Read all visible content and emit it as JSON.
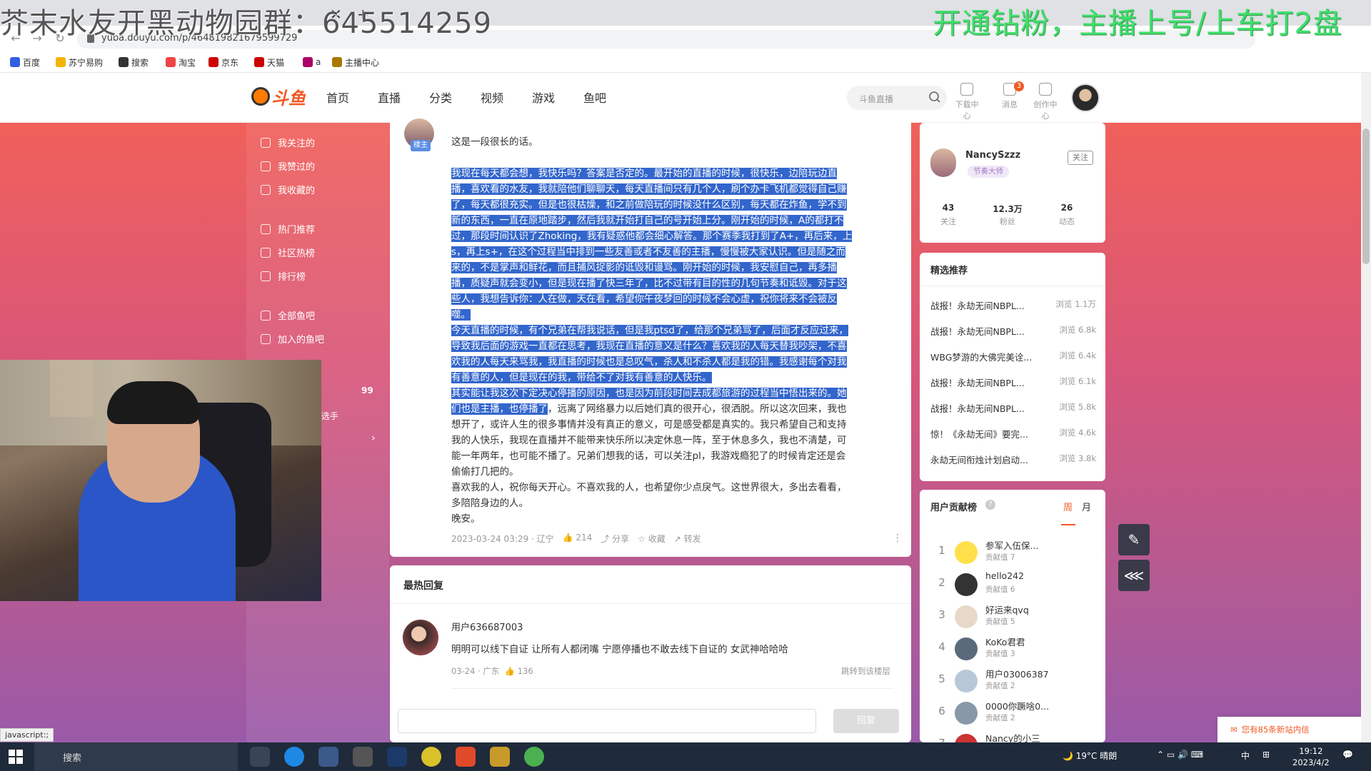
{
  "overlay": {
    "left_text": "芥末水友开黑动物园群：645514259",
    "right_text": "开通钻粉，主播上号/上车打2盘"
  },
  "browser": {
    "url": "yuba.douyu.com/p/464819821679599729",
    "bookmarks": [
      "百度",
      "苏宁易购",
      "搜索",
      "淘宝",
      "京东",
      "天猫",
      "a",
      "主播中心"
    ]
  },
  "header": {
    "logo_text": "斗鱼",
    "nav": [
      "首页",
      "直播",
      "分类",
      "视频",
      "游戏",
      "鱼吧"
    ],
    "search_placeholder": "斗鱼直播",
    "tools": [
      "下载中心",
      "消息",
      "创作中心"
    ],
    "message_badge": "3"
  },
  "left_menu": [
    "我关注的",
    "我赞过的",
    "我收藏的",
    "热门推荐",
    "社区热榜",
    "排行榜",
    "全部鱼吧",
    "加入的鱼吧"
  ],
  "left_dim": {
    "count": "99",
    "text": "选手"
  },
  "post": {
    "author_tag": "楼主",
    "intro": "这是一段很长的话。",
    "lines": [
      {
        "t": "我现在每天都会想，我快乐吗？答案是否定的。最开始的直播的时候，很快乐，边陪玩边直",
        "h": true
      },
      {
        "t": "播，喜欢看的水友，我就陪他们聊聊天，每天直播间只有几个人，刷个办卡飞机都觉得自己赚",
        "h": true
      },
      {
        "t": "了，每天都很充实。但是也很枯燥，和之前做陪玩的时候没什么区别，每天都在炸鱼，学不到",
        "h": true
      },
      {
        "t": "新的东西，一直在原地踏步，然后我就开始打自己的号开始上分。刚开始的时候，A的都打不",
        "h": true
      },
      {
        "t": "过，那段时间认识了Zhoking，我有疑惑他都会细心解答。那个赛季我打到了A+，再后来，上",
        "h": true
      },
      {
        "t": "s，再上s+，在这个过程当中排到一些友善或者不友善的主播，慢慢被大家认识。但是随之而",
        "h": true
      },
      {
        "t": "来的，不是掌声和鲜花，而且捕风捉影的诋毁和谩骂。刚开始的时候，我安慰自己，再多播",
        "h": true
      },
      {
        "t": "播，质疑声就会变小，但是现在播了快三年了，比不过带有目的性的几句节奏和诋毁。对于这",
        "h": true
      },
      {
        "t": "些人，我想告诉你：人在做，天在看，希望你午夜梦回的时候不会心虚，祝你将来不会被反",
        "h": true
      },
      {
        "t": "噬。",
        "h": true
      },
      {
        "t": "今天直播的时候，有个兄弟在帮我说话，但是我ptsd了，给那个兄弟骂了，后面才反应过来，",
        "h": true
      },
      {
        "t": "导致我后面的游戏一直都在思考，我现在直播的意义是什么？喜欢我的人每天替我吵架，不喜",
        "h": true
      },
      {
        "t": "欢我的人每天来骂我，我直播的时候也是总叹气，杀人和不杀人都是我的错。我感谢每个对我",
        "h": true
      },
      {
        "t": "有善意的人，但是现在的我，带给不了对我有善意的人快乐。",
        "h": true
      },
      {
        "t": "其实能让我这次下定决心停播的原因，也是因为前段时间去成都旅游的过程当中悟出来的。她",
        "h": true
      },
      {
        "t": "们也是主播，也停播了，远离了网络暴力以后她们真的很开心，很洒脱。所以这次回来，我也",
        "h": "partial",
        "split": "们也是主播，也停播了"
      },
      {
        "t": "想开了，或许人生的很多事情并没有真正的意义，可是感受都是真实的。我只希望自己和支持",
        "h": false
      },
      {
        "t": "我的人快乐，我现在直播并不能带来快乐所以决定休息一阵，至于休息多久，我也不清楚，可",
        "h": false
      },
      {
        "t": "能一年两年，也可能不播了。兄弟们想我的话，可以关注pl，我游戏瘾犯了的时候肯定还是会",
        "h": false
      },
      {
        "t": "偷偷打几把的。",
        "h": false
      },
      {
        "t": "喜欢我的人，祝你每天开心。不喜欢我的人，也希望你少点戾气。这世界很大，多出去看看，",
        "h": false
      },
      {
        "t": "多陪陪身边的人。",
        "h": false
      },
      {
        "t": "晚安。",
        "h": false
      }
    ],
    "meta": {
      "time": "2023-03-24 03:29 · 辽宁",
      "likes": "214",
      "share": "分享",
      "collect": "收藏",
      "forward": "转发"
    }
  },
  "hot_reply": {
    "title": "最热回复",
    "name": "用户636687003",
    "text": "明明可以线下自证 让所有人都闭嘴 宁愿停播也不敢去线下自证的 女武神哈哈哈",
    "meta": "03-24 · 广东",
    "likes": "136",
    "jump": "跳转到该楼层",
    "reply_btn": "回复"
  },
  "anchor": {
    "name": "NancySzzz",
    "badge": "节奏大师",
    "follow": "关注",
    "stats": [
      {
        "num": "43",
        "label": "关注"
      },
      {
        "num": "12.3万",
        "label": "粉丝"
      },
      {
        "num": "26",
        "label": "动态"
      }
    ]
  },
  "recommend": {
    "title": "精选推荐",
    "items": [
      {
        "t": "战报！永劫无间NBPL...",
        "v": "浏览 1.1万"
      },
      {
        "t": "战报！永劫无间NBPL...",
        "v": "浏览 6.8k"
      },
      {
        "t": "WBG梦游的大佛完美诠...",
        "v": "浏览 6.4k"
      },
      {
        "t": "战报！永劫无间NBPL...",
        "v": "浏览 6.1k"
      },
      {
        "t": "战报！永劫无间NBPL...",
        "v": "浏览 5.8k"
      },
      {
        "t": "惊！《永劫无间》要完...",
        "v": "浏览 4.6k"
      },
      {
        "t": "永劫无间衔烛计划启动...",
        "v": "浏览 3.8k"
      }
    ]
  },
  "ranking": {
    "title": "用户贡献榜",
    "tab_week": "周",
    "tab_month": "月",
    "items": [
      {
        "n": "1",
        "name": "参军入伍保...",
        "val": "贡献值 7"
      },
      {
        "n": "2",
        "name": "hello242",
        "val": "贡献值 6"
      },
      {
        "n": "3",
        "name": "好运来qvq",
        "val": "贡献值 5"
      },
      {
        "n": "4",
        "name": "KoKo君君",
        "val": "贡献值 3"
      },
      {
        "n": "5",
        "name": "用户03006387",
        "val": "贡献值 2"
      },
      {
        "n": "6",
        "name": "0000你蹶啥0...",
        "val": "贡献值 2"
      },
      {
        "n": "7",
        "name": "Nancy的小三",
        "val": ""
      }
    ]
  },
  "notice": "您有85条新站内信",
  "status_url": "javascript:;",
  "taskbar": {
    "search": "搜索",
    "weather": "19°C 晴朗",
    "ime": "中",
    "time": "19:12",
    "date": "2023/4/2"
  }
}
